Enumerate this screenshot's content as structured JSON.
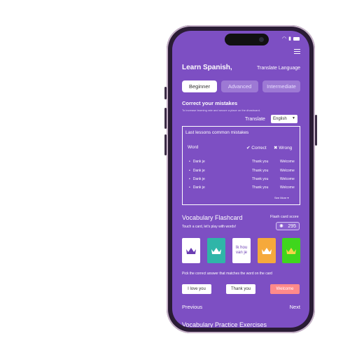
{
  "header": {
    "title": "Learn Spanish,",
    "translate_language": "Translate Language"
  },
  "tabs": [
    {
      "label": "Beginner",
      "active": true
    },
    {
      "label": "Advanced",
      "active": false
    },
    {
      "label": "Intermediate",
      "active": false
    }
  ],
  "mistakes": {
    "heading": "Correct your mistakes",
    "subtext": "To increase learning rate and secure a place on the dhasboard.",
    "translate_label": "Translate",
    "language_selected": "English",
    "panel_title": "Last lessons common mistakes",
    "col_word": "Word",
    "col_correct": "Correct",
    "col_wrong": "Wrong",
    "rows": [
      {
        "word": "Dank je",
        "correct": "Thank you",
        "wrong": "Welcome"
      },
      {
        "word": "Dank je",
        "correct": "Thank you",
        "wrong": "Welcome"
      },
      {
        "word": "Dank je",
        "correct": "Thank you",
        "wrong": "Welcome"
      },
      {
        "word": "Dank je",
        "correct": "Thank you",
        "wrong": "Welcome"
      }
    ],
    "see_more": "See More"
  },
  "flashcard": {
    "heading": "Vocabulary Flashcard",
    "touch_text": "Touch a card, let's play with words!",
    "score_label": "Flash card score",
    "score": "295",
    "card_text": "Ik hou van je",
    "card_colors": [
      "#ffffff",
      "#2fb5a8",
      "#ffffff",
      "#f6a93b",
      "#3fd61d"
    ],
    "pick_text": "Pick the correct answer that matches the word on the card",
    "answers": [
      "I love you",
      "Thank you",
      "Welcome"
    ]
  },
  "nav": {
    "previous": "Previous",
    "next": "Next"
  },
  "footer": {
    "heading": "Vocabulary Practice Exercises"
  }
}
